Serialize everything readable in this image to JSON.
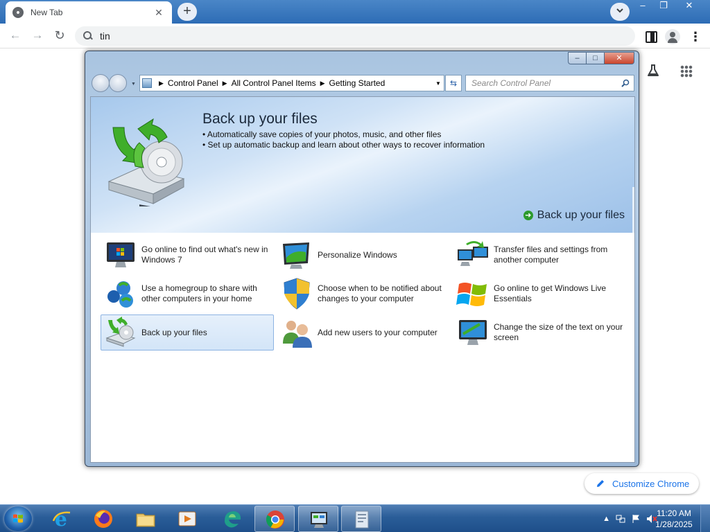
{
  "browser": {
    "tab_title": "New Tab",
    "tab_close": "✕",
    "new_tab": "+",
    "omnibox_text": "tin",
    "customize_label": "Customize Chrome",
    "window_controls": {
      "minimize": "–",
      "restore": "❐",
      "close": "✕"
    },
    "icons": [
      "chrome-icon",
      "back-icon",
      "forward-icon",
      "reload-icon",
      "search-icon",
      "side-panel-icon",
      "profile-icon",
      "menu-icon",
      "labs-icon",
      "apps-grid-icon",
      "pencil-icon"
    ]
  },
  "control_panel": {
    "breadcrumb": [
      "Control Panel",
      "All Control Panel Items",
      "Getting Started"
    ],
    "search_placeholder": "Search Control Panel",
    "banner": {
      "title": "Back up your files",
      "bullets": [
        "• Automatically save copies of your photos, music, and other files",
        "• Set up automatic backup and learn about other ways to recover information"
      ],
      "link": "Back up your files"
    },
    "tasks": [
      {
        "label": "Go online to find out what's new in Windows 7",
        "icon": "monitor-windows-icon"
      },
      {
        "label": "Personalize Windows",
        "icon": "personalize-icon"
      },
      {
        "label": "Transfer files and settings from another computer",
        "icon": "transfer-icon"
      },
      {
        "label": "Use a homegroup to share with other computers in your home",
        "icon": "homegroup-icon"
      },
      {
        "label": "Choose when to be notified about changes to your computer",
        "icon": "uac-shield-icon"
      },
      {
        "label": "Go online to get Windows Live Essentials",
        "icon": "windows-live-icon"
      },
      {
        "label": "Back up your files",
        "icon": "backup-icon",
        "selected": true
      },
      {
        "label": "Add new users to your computer",
        "icon": "users-icon"
      },
      {
        "label": "Change the size of the text on your screen",
        "icon": "display-icon"
      }
    ],
    "colors": {
      "selection": "#d3e5f8",
      "banner": "#b7d3f0"
    }
  },
  "taskbar": {
    "apps": [
      "internet-explorer-icon",
      "firefox-icon",
      "file-explorer-icon",
      "media-player-icon",
      "edge-icon",
      "chrome-icon",
      "control-panel-icon",
      "documents-icon"
    ],
    "time": "11:20 AM",
    "date": "1/28/2025",
    "tray_arrow": "▲"
  }
}
